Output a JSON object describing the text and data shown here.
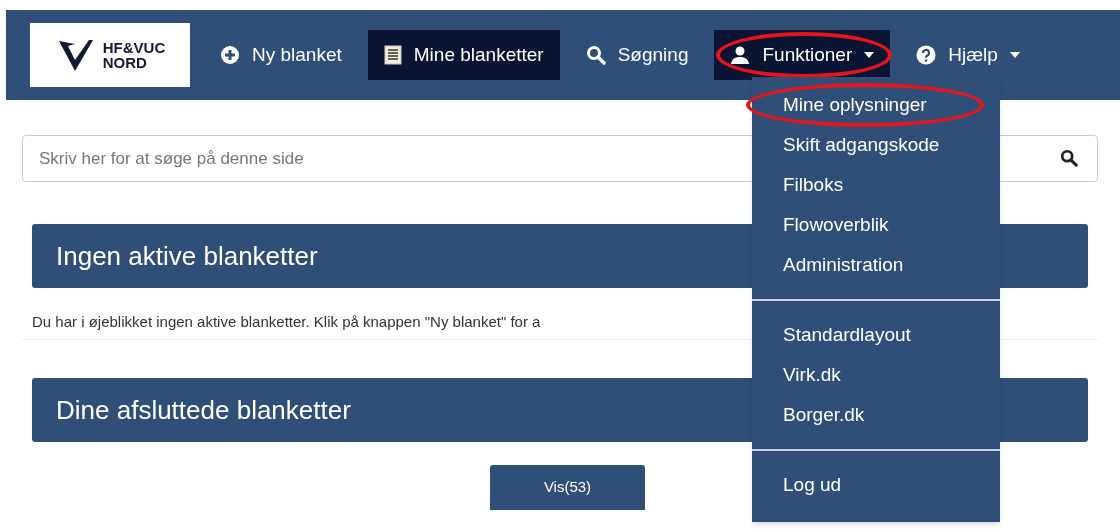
{
  "navbar": {
    "logo": {
      "line_1": "HF&VUC",
      "line_2": "NORD"
    },
    "items": [
      {
        "label": "Ny blanket",
        "selected": false,
        "highlighted": false,
        "caret": false
      },
      {
        "label": "Mine blanketter",
        "selected": true,
        "highlighted": false,
        "caret": false
      },
      {
        "label": "Søgning",
        "selected": false,
        "highlighted": false,
        "caret": false
      },
      {
        "label": "Funktioner",
        "selected": true,
        "highlighted": true,
        "caret": true
      },
      {
        "label": "Hjælp",
        "selected": false,
        "highlighted": false,
        "caret": true
      }
    ]
  },
  "dropdown": {
    "groups": [
      [
        {
          "label": "Mine oplysninger",
          "highlighted": true
        },
        {
          "label": "Skift adgangskode",
          "highlighted": false
        },
        {
          "label": "Filboks",
          "highlighted": false
        },
        {
          "label": "Flowoverblik",
          "highlighted": false
        },
        {
          "label": "Administration",
          "highlighted": false
        }
      ],
      [
        {
          "label": "Standardlayout",
          "highlighted": false
        },
        {
          "label": "Virk.dk",
          "highlighted": false
        },
        {
          "label": "Borger.dk",
          "highlighted": false
        }
      ],
      [
        {
          "label": "Log ud",
          "highlighted": false
        }
      ]
    ]
  },
  "search": {
    "placeholder": "Skriv her for at søge på denne side"
  },
  "sections": [
    {
      "title": "Ingen aktive blanketter",
      "text": "Du har i øjeblikket ingen aktive blanketter. Klik på knappen \"Ny blanket\" for a"
    },
    {
      "title": "Dine afsluttede blanketter",
      "button": "Vis(53)"
    }
  ]
}
